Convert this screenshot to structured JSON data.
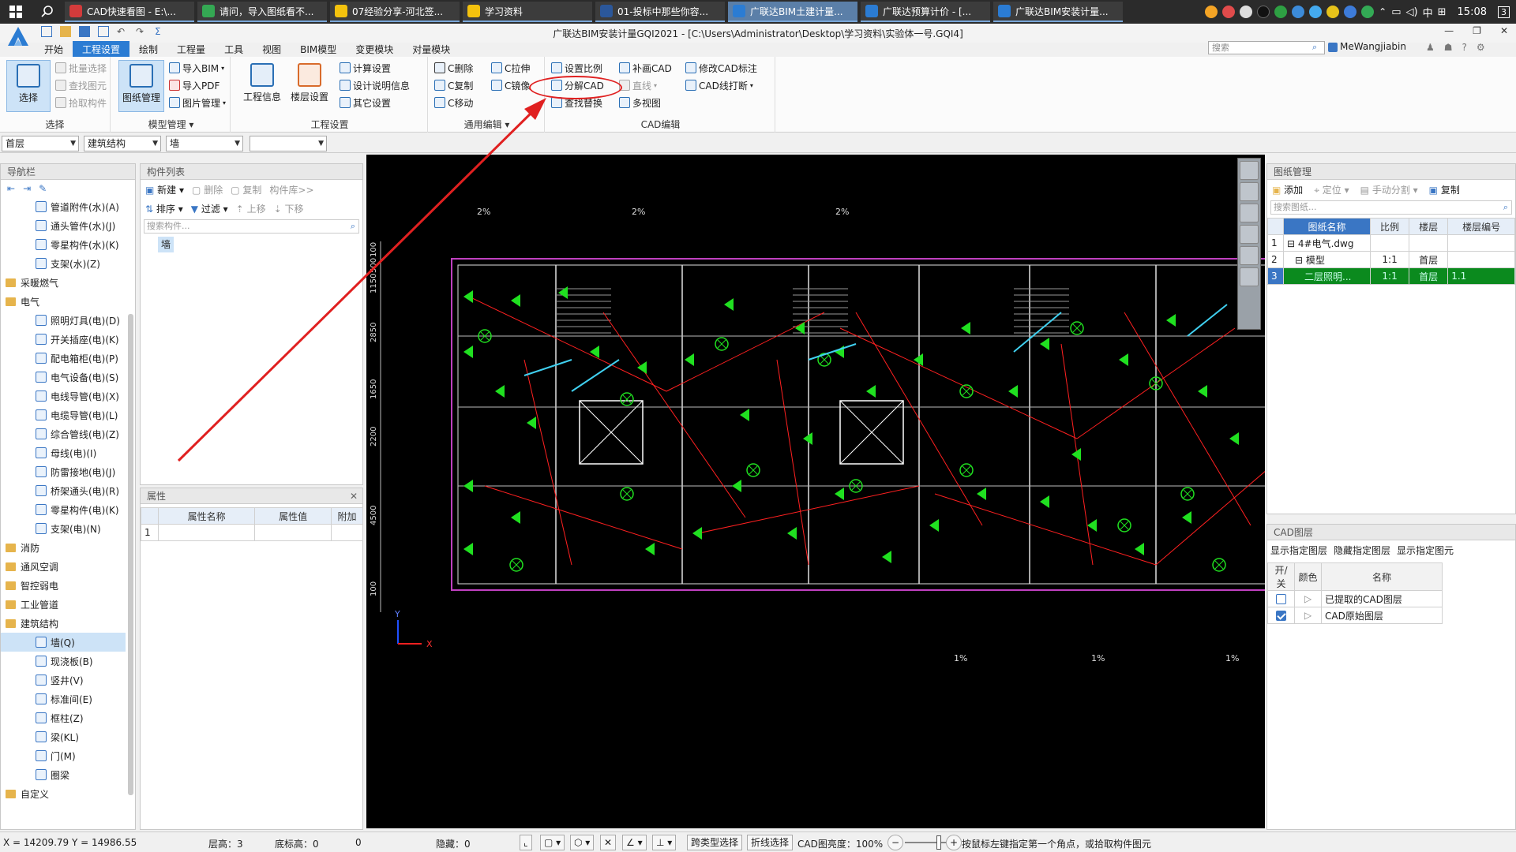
{
  "taskbar": {
    "tabs": [
      {
        "label": "CAD快速看图 - E:\\...",
        "color": "#d33b3b",
        "active": false
      },
      {
        "label": "请问，导入图纸看不...",
        "color": "#34a853",
        "active": false
      },
      {
        "label": "07经验分享-河北签...",
        "color": "#f4c20d",
        "active": false
      },
      {
        "label": "学习资料",
        "color": "#f4c20d",
        "active": false
      },
      {
        "label": "01-投标中那些你容...",
        "color": "#2b579a",
        "active": false
      },
      {
        "label": "广联达BIM土建计量...",
        "color": "#2b7cd3",
        "active": true
      },
      {
        "label": "广联达预算计价 - [...",
        "color": "#2b7cd3",
        "active": false
      },
      {
        "label": "广联达BIM安装计量...",
        "color": "#2b7cd3",
        "active": false
      }
    ],
    "ime": "中",
    "clock": "15:08",
    "notif_count": "3"
  },
  "app": {
    "title": "广联达BIM安装计量GQI2021 - [C:\\Users\\Administrator\\Desktop\\学习资料\\实验体一号.GQI4]",
    "search_placeholder": "搜索",
    "user": "MeWangjiabin"
  },
  "menu": [
    "开始",
    "工程设置",
    "绘制",
    "工程量",
    "工具",
    "视图",
    "BIM模型",
    "变更模块",
    "对量模块"
  ],
  "menu_active": "工程设置",
  "ribbon": {
    "select_group": {
      "label": "选择",
      "big": "选择",
      "items": [
        "批量选择",
        "查找图元",
        "拾取构件"
      ]
    },
    "model_group": {
      "label": "模型管理",
      "big": "图纸管理",
      "items": [
        "导入BIM",
        "导入PDF",
        "图片管理"
      ]
    },
    "project_group": {
      "label": "工程设置",
      "big1": "工程信息",
      "big2": "楼层设置",
      "items": [
        "计算设置",
        "设计说明信息",
        "其它设置"
      ]
    },
    "edit_group": {
      "label": "通用编辑",
      "items": [
        "C删除",
        "C复制",
        "C移动",
        "C拉伸",
        "C镜像"
      ]
    },
    "cad_group": {
      "label": "CAD编辑",
      "items": [
        "设置比例",
        "分解CAD",
        "查找替换",
        "补画CAD",
        "直线",
        "多视图",
        "修改CAD标注",
        "CAD线打断"
      ]
    }
  },
  "toolbar2": {
    "floor": "首层",
    "category": "建筑结构",
    "type": "墙",
    "sub": ""
  },
  "nav": {
    "title": "导航栏",
    "rows": [
      {
        "label": "管道附件(水)(A)",
        "kind": "item"
      },
      {
        "label": "通头管件(水)(J)",
        "kind": "item"
      },
      {
        "label": "零星构件(水)(K)",
        "kind": "item"
      },
      {
        "label": "支架(水)(Z)",
        "kind": "item"
      },
      {
        "label": "采暖燃气",
        "kind": "folder"
      },
      {
        "label": "电气",
        "kind": "folder"
      },
      {
        "label": "照明灯具(电)(D)",
        "kind": "item"
      },
      {
        "label": "开关插座(电)(K)",
        "kind": "item"
      },
      {
        "label": "配电箱柜(电)(P)",
        "kind": "item"
      },
      {
        "label": "电气设备(电)(S)",
        "kind": "item"
      },
      {
        "label": "电线导管(电)(X)",
        "kind": "item"
      },
      {
        "label": "电缆导管(电)(L)",
        "kind": "item"
      },
      {
        "label": "综合管线(电)(Z)",
        "kind": "item"
      },
      {
        "label": "母线(电)(I)",
        "kind": "item"
      },
      {
        "label": "防雷接地(电)(J)",
        "kind": "item"
      },
      {
        "label": "桥架通头(电)(R)",
        "kind": "item"
      },
      {
        "label": "零星构件(电)(K)",
        "kind": "item"
      },
      {
        "label": "支架(电)(N)",
        "kind": "item"
      },
      {
        "label": "消防",
        "kind": "folder"
      },
      {
        "label": "通风空调",
        "kind": "folder"
      },
      {
        "label": "智控弱电",
        "kind": "folder"
      },
      {
        "label": "工业管道",
        "kind": "folder"
      },
      {
        "label": "建筑结构",
        "kind": "folder"
      },
      {
        "label": "墙(Q)",
        "kind": "item",
        "selected": true
      },
      {
        "label": "现浇板(B)",
        "kind": "item"
      },
      {
        "label": "竖井(V)",
        "kind": "item"
      },
      {
        "label": "标准间(E)",
        "kind": "item"
      },
      {
        "label": "框柱(Z)",
        "kind": "item"
      },
      {
        "label": "梁(KL)",
        "kind": "item"
      },
      {
        "label": "门(M)",
        "kind": "item"
      },
      {
        "label": "圈梁",
        "kind": "item"
      },
      {
        "label": "自定义",
        "kind": "folder"
      }
    ]
  },
  "component_list": {
    "title": "构件列表",
    "buttons": [
      "新建",
      "删除",
      "复制",
      "构件库>>"
    ],
    "sort": "排序",
    "filter": "过滤",
    "up": "上移",
    "down": "下移",
    "search_placeholder": "搜索构件...",
    "items": [
      "墙"
    ]
  },
  "properties": {
    "title": "属性",
    "columns": [
      "属性名称",
      "属性值",
      "附加"
    ],
    "rows": [
      {
        "n": "1"
      }
    ]
  },
  "drawing_mgmt": {
    "title": "图纸管理",
    "buttons": [
      "添加",
      "定位",
      "手动分割",
      "复制"
    ],
    "search_placeholder": "搜索图纸...",
    "columns": [
      "图纸名称",
      "比例",
      "楼层",
      "楼层编号"
    ],
    "rows": [
      {
        "n": "1",
        "name": "4#电气.dwg",
        "scale": "",
        "floor": "",
        "code": ""
      },
      {
        "n": "2",
        "name": "模型",
        "scale": "1:1",
        "floor": "首层",
        "code": ""
      },
      {
        "n": "3",
        "name": "二层照明...",
        "scale": "1:1",
        "floor": "首层",
        "code": "1.1"
      }
    ]
  },
  "cad_layers": {
    "title": "CAD图层",
    "actions": [
      "显示指定图层",
      "隐藏指定图层",
      "显示指定图元"
    ],
    "columns": [
      "开/关",
      "颜色",
      "名称"
    ],
    "rows": [
      {
        "name": "已提取的CAD图层",
        "on": false
      },
      {
        "name": "CAD原始图层",
        "on": true
      }
    ]
  },
  "canvas": {
    "slopes": [
      "2%",
      "2%",
      "2%",
      "1%",
      "1%",
      "1%",
      "1%"
    ],
    "dims_left": [
      "100",
      "500",
      "1150",
      "2850",
      "1650",
      "2200",
      "4500",
      "100"
    ],
    "axis_x": "X",
    "axis_y": "Y"
  },
  "status": {
    "coords": "X = 14209.79 Y = 14986.55",
    "floor_height_label": "层高：3",
    "base_height_label": "底标高：0",
    "zero": "0",
    "hidden_label": "隐藏：0",
    "btn_cross_select": "跨类型选择",
    "btn_fold_select": "折线选择",
    "cad_brightness": "CAD图亮度：100%",
    "hint": "按鼠标左键指定第一个角点，或拾取构件图元"
  }
}
